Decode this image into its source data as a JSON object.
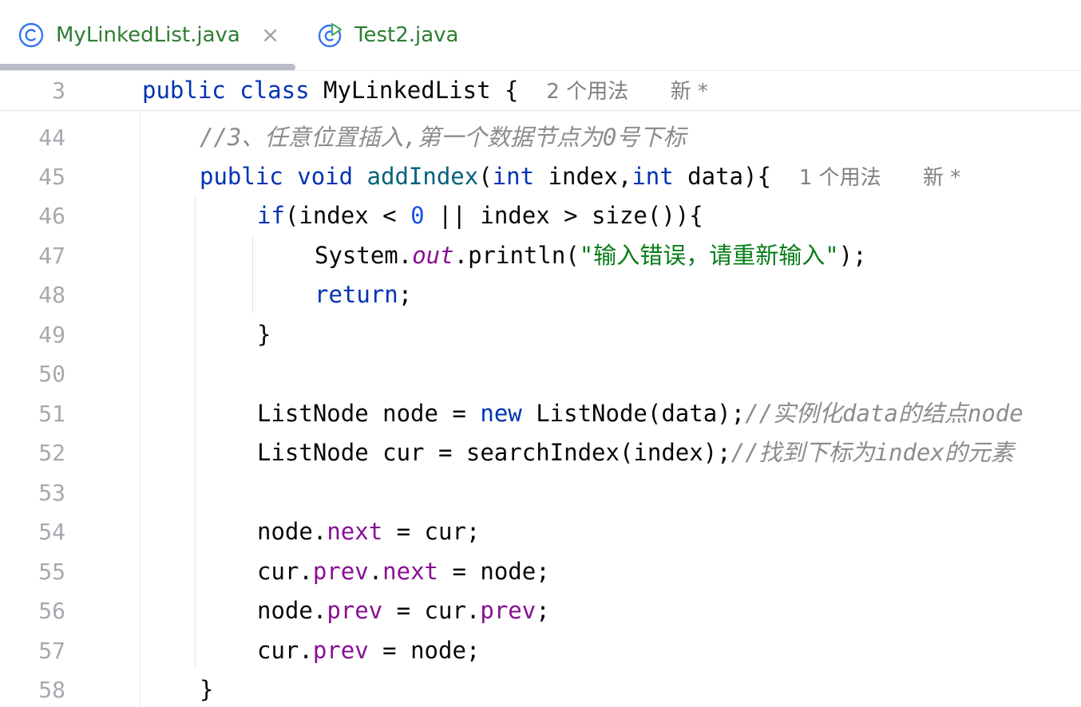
{
  "tabs": [
    {
      "label": "MyLinkedList.java",
      "active": true,
      "icon": "class-icon",
      "close": "×"
    },
    {
      "label": "Test2.java",
      "active": false,
      "icon": "runnable-class-icon"
    }
  ],
  "sticky": {
    "line_number": "3",
    "kw1": "public",
    "kw2": "class",
    "name": "MyLinkedList",
    "brace": "{",
    "usages": "2 个用法",
    "new_mark": "新 *"
  },
  "code": {
    "l44": {
      "n": "44",
      "comment": "//3、任意位置插入,第一个数据节点为0号下标"
    },
    "l45": {
      "n": "45",
      "kw1": "public",
      "kw2": "void",
      "fn": "addIndex",
      "p1": "(",
      "kw3": "int",
      "p2": " index,",
      "kw4": "int",
      "p3": " data){",
      "usages": "1 个用法",
      "new_mark": "新 *"
    },
    "l46": {
      "n": "46",
      "kw": "if",
      "a": "(index < ",
      "num": "0",
      "b": " || index > size()){"
    },
    "l47": {
      "n": "47",
      "a": "System.",
      "static": "out",
      "b": ".println(",
      "str": "\"输入错误，请重新输入\"",
      "c": ");"
    },
    "l48": {
      "n": "48",
      "kw": "return",
      "a": ";"
    },
    "l49": {
      "n": "49",
      "a": "}"
    },
    "l50": {
      "n": "50"
    },
    "l51": {
      "n": "51",
      "a": "ListNode node = ",
      "kw": "new",
      "b": " ListNode(data);",
      "comment": "//实例化data的结点node"
    },
    "l52": {
      "n": "52",
      "a": "ListNode cur = searchIndex(index);",
      "comment": "//找到下标为index的元素"
    },
    "l53": {
      "n": "53"
    },
    "l54": {
      "n": "54",
      "a": "node.",
      "f1": "next",
      "b": " = cur;"
    },
    "l55": {
      "n": "55",
      "a": "cur.",
      "f1": "prev",
      "b": ".",
      "f2": "next",
      "c": " = node;"
    },
    "l56": {
      "n": "56",
      "a": "node.",
      "f1": "prev",
      "b": " = cur.",
      "f2": "prev",
      "c": ";"
    },
    "l57": {
      "n": "57",
      "a": "cur.",
      "f1": "prev",
      "b": " = node;"
    },
    "l58": {
      "n": "58",
      "a": "}"
    }
  },
  "colors": {
    "keyword": "#0033b3",
    "string": "#067d17",
    "number": "#1750eb",
    "field": "#871094",
    "comment": "#8c8c8c",
    "tab_text": "#2e7d32"
  }
}
